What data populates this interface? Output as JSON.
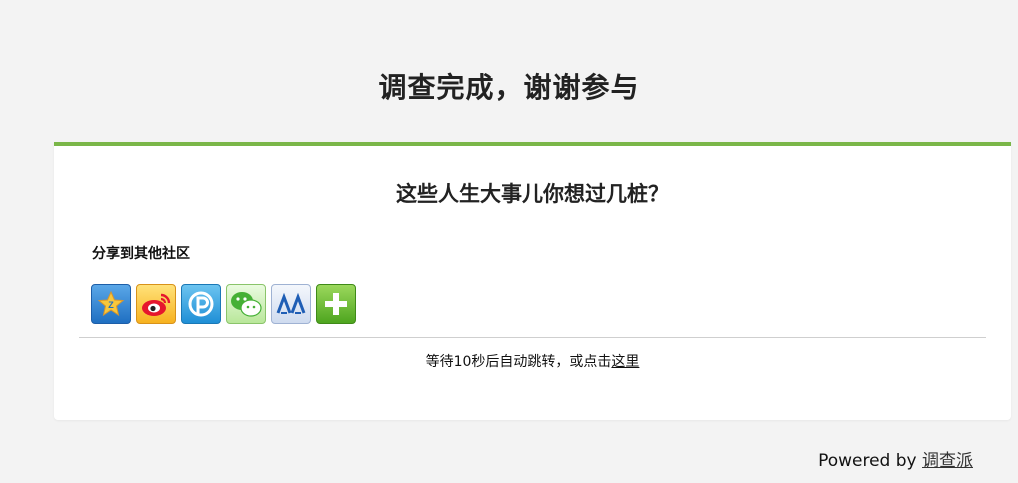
{
  "header": {
    "title": "调查完成，谢谢参与"
  },
  "survey": {
    "title": "这些人生大事儿你想过几桩？"
  },
  "share": {
    "label": "分享到其他社区",
    "icons": [
      {
        "name": "qzone-icon"
      },
      {
        "name": "weibo-icon"
      },
      {
        "name": "pengyou-icon"
      },
      {
        "name": "wechat-icon"
      },
      {
        "name": "renren-icon"
      },
      {
        "name": "more-share-icon"
      }
    ]
  },
  "redirect": {
    "text": "等待10秒后自动跳转，或点击",
    "link": "这里"
  },
  "footer": {
    "powered_by": "Powered by",
    "brand": "调查派"
  },
  "colors": {
    "accent": "#7ab648",
    "background": "#f3f3f3",
    "card": "#ffffff"
  }
}
